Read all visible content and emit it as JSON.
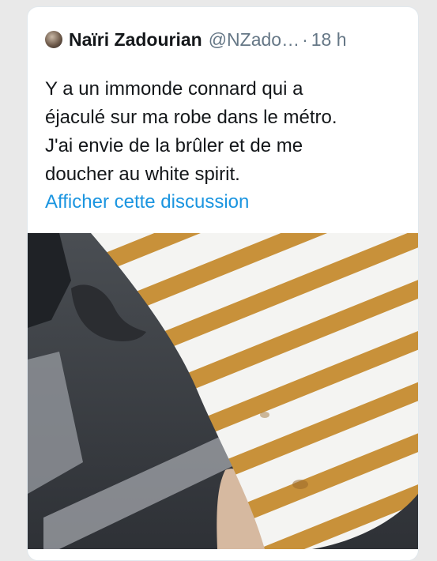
{
  "tweet": {
    "author_name": "Naïri Zadourian",
    "handle": "@NZado…",
    "separator": "·",
    "time": "18 h",
    "text_lines": [
      "Y a un immonde connard qui a",
      "éjaculé sur ma robe dans le métro.",
      "J'ai envie de la brûler et de me",
      "doucher au white spirit."
    ],
    "thread_link": "Afficher cette discussion"
  },
  "media": {
    "description_icon": "photo",
    "colors": {
      "stripe": "#c8913a",
      "fabric": "#f4f4f2",
      "floor": "#3f4246",
      "shadow": "#1f2226"
    }
  }
}
